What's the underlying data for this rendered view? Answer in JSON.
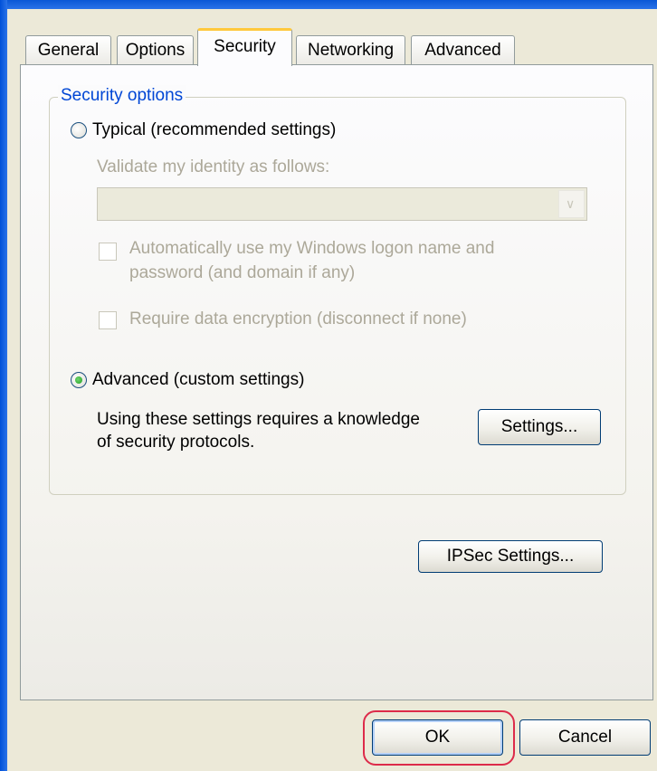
{
  "tabs": [
    {
      "label": "General"
    },
    {
      "label": "Options"
    },
    {
      "label": "Security",
      "active": true
    },
    {
      "label": "Networking"
    },
    {
      "label": "Advanced"
    }
  ],
  "security_options": {
    "group_label": "Security options",
    "typical": {
      "label": "Typical (recommended settings)",
      "selected": false
    },
    "validate_label": "Validate my identity as follows:",
    "identity_dropdown": {
      "value": "",
      "icon": "chevron-down-icon"
    },
    "auto_logon": {
      "label_line1": "Automatically use my Windows logon name and",
      "label_line2": "password (and domain if any)",
      "checked": false
    },
    "require_encryption": {
      "label": "Require data encryption (disconnect if none)",
      "checked": false
    },
    "advanced": {
      "label": "Advanced (custom settings)",
      "selected": true
    },
    "advanced_desc_line1": "Using these settings requires a knowledge",
    "advanced_desc_line2": "of security protocols.",
    "settings_button": "Settings..."
  },
  "ipsec_button": "IPSec Settings...",
  "footer": {
    "ok": "OK",
    "cancel": "Cancel"
  },
  "colors": {
    "group_label": "#0046d5",
    "disabled_text": "#aca899",
    "highlight": "#dd2b4a",
    "active_tab_accent": "#ffc83c"
  }
}
